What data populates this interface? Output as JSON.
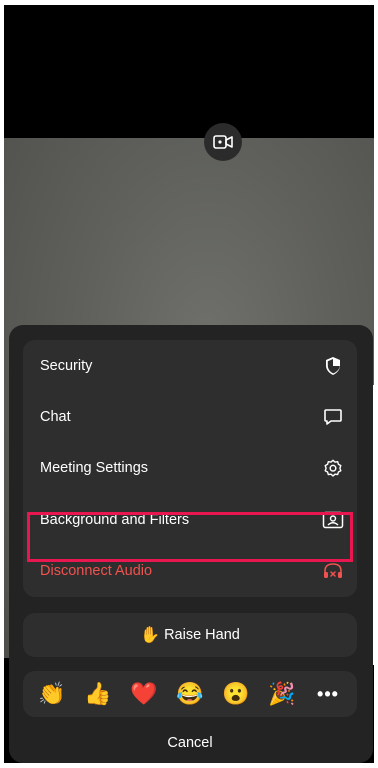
{
  "camera": {
    "icon": "video-camera-icon"
  },
  "menu": {
    "items": [
      {
        "label": "Security",
        "icon": "shield-icon"
      },
      {
        "label": "Chat",
        "icon": "chat-bubble-icon"
      },
      {
        "label": "Meeting Settings",
        "icon": "gear-icon"
      },
      {
        "label": "Background and Filters",
        "icon": "portrait-frame-icon",
        "highlighted": true
      },
      {
        "label": "Disconnect Audio",
        "icon": "headphones-x-icon",
        "color": "#f0524f"
      }
    ]
  },
  "raise_hand": {
    "emoji": "✋",
    "label": "Raise Hand"
  },
  "reactions": {
    "items": [
      {
        "emoji": "👏",
        "icon": "clapping-hands-icon"
      },
      {
        "emoji": "👍",
        "icon": "thumbs-up-icon"
      },
      {
        "emoji": "❤️",
        "icon": "heart-icon"
      },
      {
        "emoji": "😂",
        "icon": "tears-of-joy-icon"
      },
      {
        "emoji": "😮",
        "icon": "surprised-face-icon"
      },
      {
        "emoji": "🎉",
        "icon": "party-popper-icon"
      }
    ],
    "more": "•••"
  },
  "cancel": {
    "label": "Cancel"
  },
  "colors": {
    "sheet": "#232323",
    "group": "#2e2e2e",
    "highlight": "#e8174f",
    "danger": "#f0524f"
  }
}
